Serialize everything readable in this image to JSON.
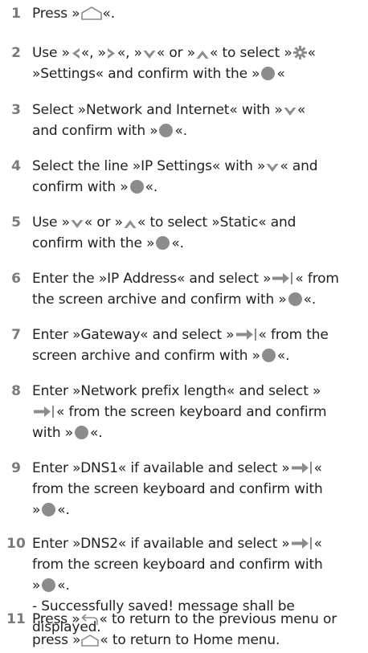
{
  "steps": [
    {
      "num": "1",
      "t1": "Press »",
      "t2": "«."
    },
    {
      "num": "2",
      "t1": "Use »",
      "t2": "«, »",
      "t3": "«, »",
      "t4": "« or »",
      "t5": "« to select »",
      "t6": "«",
      "t7": "»Settings« and confirm with the »",
      "t8": "«"
    },
    {
      "num": "3",
      "t1": "Select »Network and Internet« with »",
      "t2": "«",
      "t3": "and confirm with »",
      "t4": "«."
    },
    {
      "num": "4",
      "t1": "Select the line »IP Settings« with »",
      "t2": "« and",
      "t3": "confirm with »",
      "t4": "«."
    },
    {
      "num": "5",
      "t1": "Use »",
      "t2": "« or »",
      "t3": "« to select »Static« and",
      "t4": "confirm with the »",
      "t5": "«."
    },
    {
      "num": "6",
      "t1": "Enter the »IP Address« and select »",
      "t2": "« from",
      "t3": "the screen archive and confirm with »",
      "t4": "«."
    },
    {
      "num": "7",
      "t1": "Enter »Gateway« and select »",
      "t2": "« from the",
      "t3": "screen archive and confirm with »",
      "t4": "«."
    },
    {
      "num": "8",
      "t1": "Enter »Network prefix length« and select »",
      "t2": "« from the screen keyboard and confirm",
      "t3": "with »",
      "t4": "«."
    },
    {
      "num": "9",
      "t1": "Enter »DNS1« if available and select »",
      "t2": "«",
      "t3": "from the screen keyboard and confirm with",
      "t4": "»",
      "t5": "«."
    },
    {
      "num": "10",
      "t1": "Enter »DNS2« if available and select »",
      "t2": "«",
      "t3": "from the screen keyboard and confirm with",
      "t4": "»",
      "t5": "«.",
      "t6": "- Successfully saved! message shall be",
      "t7": "displayed."
    },
    {
      "num": "11",
      "t1": "Press »",
      "t2": "« to return to the previous menu or",
      "t3": "press »",
      "t4": "« to return to Home menu."
    }
  ]
}
